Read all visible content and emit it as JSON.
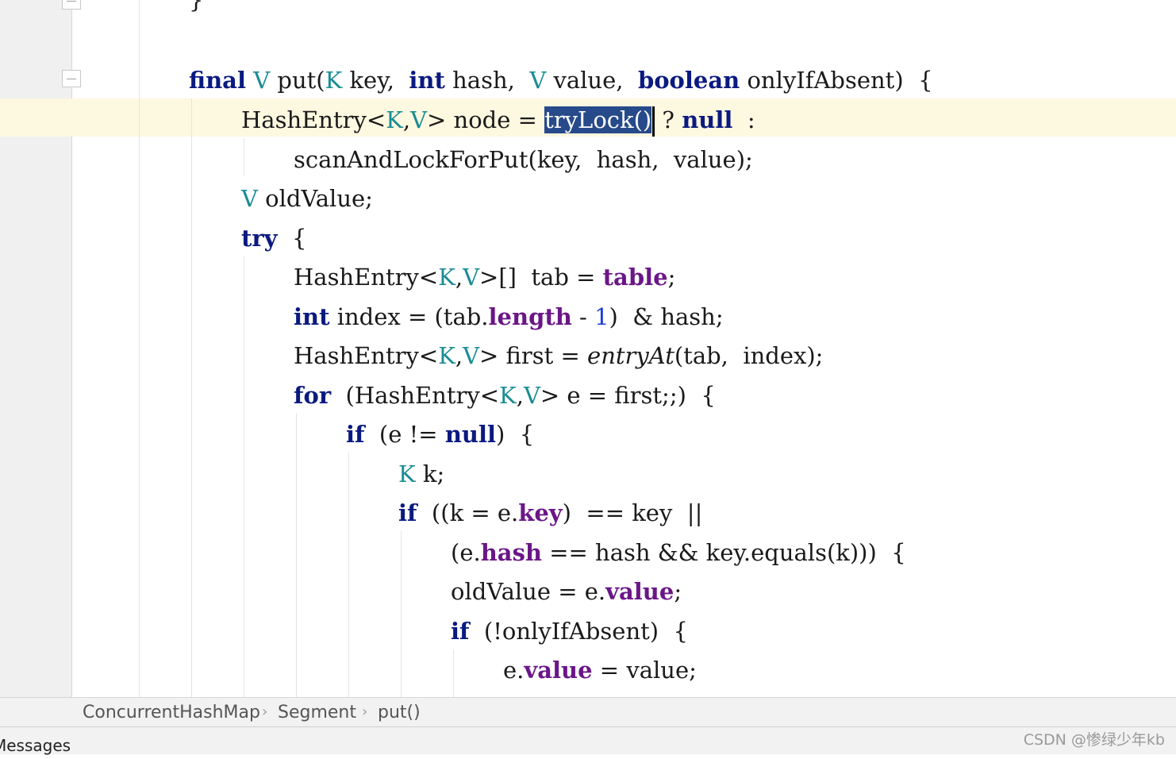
{
  "editor": {
    "lines": [
      {
        "id": "l0",
        "tokens": [
          {
            "t": "}",
            "c": "pl"
          }
        ]
      },
      {
        "id": "l1",
        "tokens": [
          {
            "t": "final",
            "c": "kw"
          },
          {
            "t": " ",
            "c": "pl"
          },
          {
            "t": "V",
            "c": "tp"
          },
          {
            "t": " put(",
            "c": "pl"
          },
          {
            "t": "K",
            "c": "tp"
          },
          {
            "t": " key,  ",
            "c": "pl"
          },
          {
            "t": "int",
            "c": "kw"
          },
          {
            "t": " hash,  ",
            "c": "pl"
          },
          {
            "t": "V",
            "c": "tp"
          },
          {
            "t": " value,  ",
            "c": "pl"
          },
          {
            "t": "boolean",
            "c": "kw"
          },
          {
            "t": " onlyIfAbsent)  {",
            "c": "pl"
          }
        ]
      },
      {
        "id": "l2",
        "tokens": [
          {
            "t": "HashEntry<",
            "c": "pl"
          },
          {
            "t": "K",
            "c": "tp"
          },
          {
            "t": ",",
            "c": "pl"
          },
          {
            "t": "V",
            "c": "tp"
          },
          {
            "t": "> node = ",
            "c": "pl"
          },
          {
            "t": "tryLock()",
            "c": "sel"
          },
          {
            "t": "",
            "c": "cursor"
          },
          {
            "t": " ? ",
            "c": "pl"
          },
          {
            "t": "null",
            "c": "kw"
          },
          {
            "t": "  :",
            "c": "pl"
          }
        ]
      },
      {
        "id": "l3",
        "tokens": [
          {
            "t": "scanAndLockForPut(key,  hash,  value);",
            "c": "pl"
          }
        ]
      },
      {
        "id": "l4",
        "tokens": [
          {
            "t": "V",
            "c": "tp"
          },
          {
            "t": " oldValue;",
            "c": "pl"
          }
        ]
      },
      {
        "id": "l5",
        "tokens": [
          {
            "t": "try",
            "c": "kw"
          },
          {
            "t": "  {",
            "c": "pl"
          }
        ]
      },
      {
        "id": "l6",
        "tokens": [
          {
            "t": "HashEntry<",
            "c": "pl"
          },
          {
            "t": "K",
            "c": "tp"
          },
          {
            "t": ",",
            "c": "pl"
          },
          {
            "t": "V",
            "c": "tp"
          },
          {
            "t": ">[]  tab = ",
            "c": "pl"
          },
          {
            "t": "table",
            "c": "fd"
          },
          {
            "t": ";",
            "c": "pl"
          }
        ]
      },
      {
        "id": "l7",
        "tokens": [
          {
            "t": "int",
            "c": "kw"
          },
          {
            "t": " index = (tab.",
            "c": "pl"
          },
          {
            "t": "length",
            "c": "fd"
          },
          {
            "t": " - ",
            "c": "pl"
          },
          {
            "t": "1",
            "c": "num"
          },
          {
            "t": ")  & hash;",
            "c": "pl"
          }
        ]
      },
      {
        "id": "l8",
        "tokens": [
          {
            "t": "HashEntry<",
            "c": "pl"
          },
          {
            "t": "K",
            "c": "tp"
          },
          {
            "t": ",",
            "c": "pl"
          },
          {
            "t": "V",
            "c": "tp"
          },
          {
            "t": "> first = ",
            "c": "pl"
          },
          {
            "t": "entryAt",
            "c": "it"
          },
          {
            "t": "(tab,  index);",
            "c": "pl"
          }
        ]
      },
      {
        "id": "l9",
        "tokens": [
          {
            "t": "for",
            "c": "kw"
          },
          {
            "t": "  (HashEntry<",
            "c": "pl"
          },
          {
            "t": "K",
            "c": "tp"
          },
          {
            "t": ",",
            "c": "pl"
          },
          {
            "t": "V",
            "c": "tp"
          },
          {
            "t": "> e = first;;)  {",
            "c": "pl"
          }
        ]
      },
      {
        "id": "l10",
        "tokens": [
          {
            "t": "if",
            "c": "kw"
          },
          {
            "t": "  (e != ",
            "c": "pl"
          },
          {
            "t": "null",
            "c": "kw"
          },
          {
            "t": ")  {",
            "c": "pl"
          }
        ]
      },
      {
        "id": "l11",
        "tokens": [
          {
            "t": "K",
            "c": "tp"
          },
          {
            "t": " k;",
            "c": "pl"
          }
        ]
      },
      {
        "id": "l12",
        "tokens": [
          {
            "t": "if",
            "c": "kw"
          },
          {
            "t": "  ((k = e.",
            "c": "pl"
          },
          {
            "t": "key",
            "c": "fd"
          },
          {
            "t": ")  == key  ||",
            "c": "pl"
          }
        ]
      },
      {
        "id": "l13",
        "tokens": [
          {
            "t": "(e.",
            "c": "pl"
          },
          {
            "t": "hash",
            "c": "fd"
          },
          {
            "t": " == hash && key.equals(k)))  {",
            "c": "pl"
          }
        ]
      },
      {
        "id": "l14",
        "tokens": [
          {
            "t": "oldValue = e.",
            "c": "pl"
          },
          {
            "t": "value",
            "c": "fd"
          },
          {
            "t": ";",
            "c": "pl"
          }
        ]
      },
      {
        "id": "l15",
        "tokens": [
          {
            "t": "if",
            "c": "kw"
          },
          {
            "t": "  (!onlyIfAbsent)  {",
            "c": "pl"
          }
        ]
      },
      {
        "id": "l16",
        "tokens": [
          {
            "t": "e.",
            "c": "pl"
          },
          {
            "t": "value",
            "c": "fd"
          },
          {
            "t": " = value;",
            "c": "pl"
          }
        ]
      }
    ]
  },
  "breadcrumb": {
    "items": [
      "ConcurrentHashMap",
      "Segment",
      "put()"
    ],
    "separator": "›"
  },
  "bottom_panel": {
    "messages_tab": "Messages"
  },
  "watermark": "CSDN @惨绿少年kb",
  "colors": {
    "keyword": "#0a1a80",
    "type_param": "#1a8c94",
    "field": "#6b1688",
    "number": "#1a3bd8",
    "selection": "#274a8a",
    "caret_row": "#fdf8e0"
  }
}
